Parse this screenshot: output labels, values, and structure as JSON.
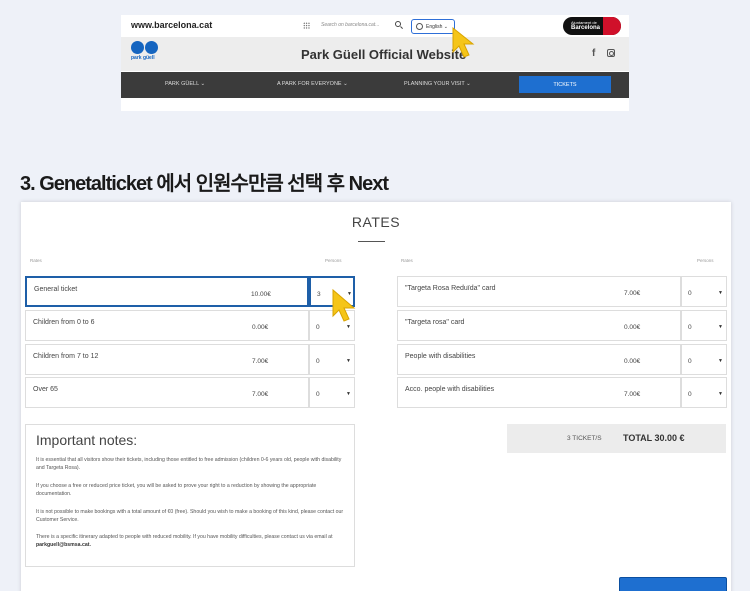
{
  "site": {
    "domain": "www.barcelona.cat",
    "search_placeholder": "Search on barcelona.cat...",
    "language": "English ⌄",
    "bcn_small": "Ajuntament de",
    "bcn_name": "Barcelona",
    "logo_text": "park güell",
    "title": "Park Güell Official Website",
    "fb": "f",
    "nav": [
      {
        "label": "PARK GÜELL ⌄"
      },
      {
        "label": "A PARK FOR EVERYONE ⌄"
      },
      {
        "label": "PLANNING YOUR VISIT ⌄"
      }
    ],
    "tickets": "TICKETS"
  },
  "heading": "3. Genetalticket 에서 인원수만큼 선택 후 Next",
  "rates": {
    "title": "RATES",
    "col_rates": "Rates",
    "col_persons": "Persons",
    "left_rows": [
      {
        "name": "General ticket",
        "price": "10.00€",
        "qty": "3"
      },
      {
        "name": "Children from 0 to 6",
        "price": "0.00€",
        "qty": "0"
      },
      {
        "name": "Children from 7 to 12",
        "price": "7.00€",
        "qty": "0"
      },
      {
        "name": "Over 65",
        "price": "7.00€",
        "qty": "0"
      }
    ],
    "right_rows": [
      {
        "name": "\"Targeta Rosa Reduïda\" card",
        "price": "7.00€",
        "qty": "0"
      },
      {
        "name": "\"Targeta rosa\" card",
        "price": "0.00€",
        "qty": "0"
      },
      {
        "name": "People with disabilities",
        "price": "0.00€",
        "qty": "0"
      },
      {
        "name": "Acco. people with disabilities",
        "price": "7.00€",
        "qty": "0"
      }
    ],
    "arrow": "▼"
  },
  "notes": {
    "title": "Important notes:",
    "p1": "It is essential that all visitors show their tickets, including those entitled to free admission (children 0-6 years old, people with disability and Targeta Rosa).",
    "p2": "If you choose a free or reduced price ticket, you will be asked to prove your right to a reduction by showing the appropriate documentation.",
    "p3": "It is not possible to make bookings with a total amount of €0 (free). Should you wish to make a booking of this kind, please contact our Customer Service.",
    "p4": "There is a specific itinerary adapted to people with reduced mobility. If you have mobility difficulties, please contact us via email at",
    "p4_email": "parkguell@bsmsa.cat."
  },
  "total": {
    "count": "3 TICKET/S",
    "label": "TOTAL 30.00 €"
  },
  "colors": {
    "accent": "#1e6fd0",
    "highlight": "#1e5fa8",
    "cursor": "#f5c518"
  }
}
